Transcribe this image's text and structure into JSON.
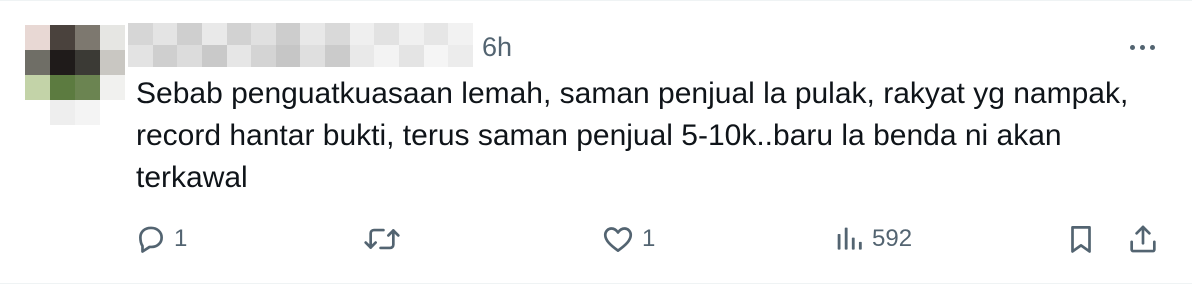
{
  "tweet": {
    "time": "6h",
    "lines": [
      "Sebab penguatkuasaan lemah, saman penjual la pulak, rakyat yg nampak,",
      "record hantar bukti, terus saman penjual 5-10k..baru la benda ni akan",
      "terkawal"
    ]
  },
  "actions": {
    "reply_count": "1",
    "like_count": "1",
    "views_count": "592"
  },
  "icons": {
    "reply": "speech-bubble-icon",
    "retweet": "retweet-arrows-icon",
    "like": "heart-icon",
    "views": "bar-chart-icon",
    "bookmark": "bookmark-icon",
    "share": "upload-arrow-icon",
    "more": "ellipsis-icon"
  },
  "colors": {
    "text": "#0f1419",
    "secondary": "#536471"
  }
}
